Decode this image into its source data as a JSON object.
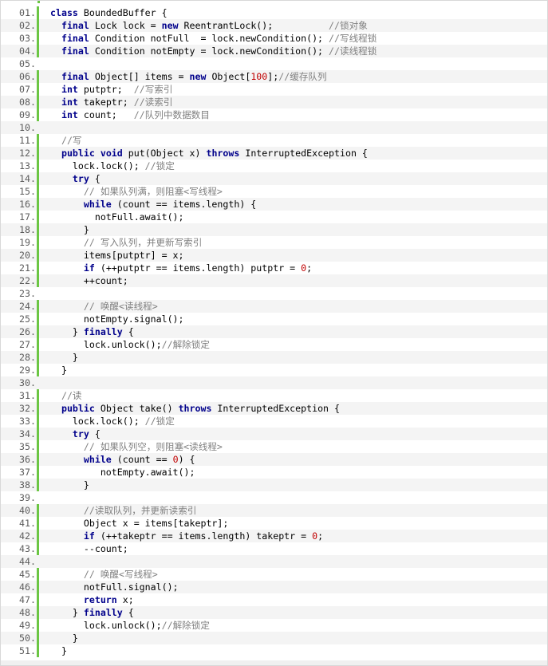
{
  "lines": [
    {
      "n": "01.",
      "segs": [
        {
          "t": "class",
          "c": "kw"
        },
        {
          "t": " BoundedBuffer {"
        }
      ]
    },
    {
      "n": "02.",
      "segs": [
        {
          "t": "  "
        },
        {
          "t": "final",
          "c": "kw"
        },
        {
          "t": " Lock lock = "
        },
        {
          "t": "new",
          "c": "kw"
        },
        {
          "t": " ReentrantLock();          "
        },
        {
          "t": "//锁对象",
          "c": "cm"
        }
      ]
    },
    {
      "n": "03.",
      "segs": [
        {
          "t": "  "
        },
        {
          "t": "final",
          "c": "kw"
        },
        {
          "t": " Condition notFull  = lock.newCondition(); "
        },
        {
          "t": "//写线程锁",
          "c": "cm"
        }
      ]
    },
    {
      "n": "04.",
      "segs": [
        {
          "t": "  "
        },
        {
          "t": "final",
          "c": "kw"
        },
        {
          "t": " Condition notEmpty = lock.newCondition(); "
        },
        {
          "t": "//读线程锁",
          "c": "cm"
        }
      ]
    },
    {
      "n": "05.",
      "segs": []
    },
    {
      "n": "06.",
      "segs": [
        {
          "t": "  "
        },
        {
          "t": "final",
          "c": "kw"
        },
        {
          "t": " Object[] items = "
        },
        {
          "t": "new",
          "c": "kw"
        },
        {
          "t": " Object["
        },
        {
          "t": "100",
          "c": "num"
        },
        {
          "t": "];"
        },
        {
          "t": "//缓存队列",
          "c": "cm"
        }
      ]
    },
    {
      "n": "07.",
      "segs": [
        {
          "t": "  "
        },
        {
          "t": "int",
          "c": "kw"
        },
        {
          "t": " putptr;  "
        },
        {
          "t": "//写索引",
          "c": "cm"
        }
      ]
    },
    {
      "n": "08.",
      "segs": [
        {
          "t": "  "
        },
        {
          "t": "int",
          "c": "kw"
        },
        {
          "t": " takeptr; "
        },
        {
          "t": "//读索引",
          "c": "cm"
        }
      ]
    },
    {
      "n": "09.",
      "segs": [
        {
          "t": "  "
        },
        {
          "t": "int",
          "c": "kw"
        },
        {
          "t": " count;   "
        },
        {
          "t": "//队列中数据数目",
          "c": "cm"
        }
      ]
    },
    {
      "n": "10.",
      "segs": []
    },
    {
      "n": "11.",
      "segs": [
        {
          "t": "  "
        },
        {
          "t": "//写",
          "c": "cm"
        }
      ]
    },
    {
      "n": "12.",
      "segs": [
        {
          "t": "  "
        },
        {
          "t": "public",
          "c": "kw"
        },
        {
          "t": " "
        },
        {
          "t": "void",
          "c": "kw"
        },
        {
          "t": " put(Object x) "
        },
        {
          "t": "throws",
          "c": "kw"
        },
        {
          "t": " InterruptedException {"
        }
      ]
    },
    {
      "n": "13.",
      "segs": [
        {
          "t": "    lock.lock(); "
        },
        {
          "t": "//锁定",
          "c": "cm"
        }
      ]
    },
    {
      "n": "14.",
      "segs": [
        {
          "t": "    "
        },
        {
          "t": "try",
          "c": "kw"
        },
        {
          "t": " {"
        }
      ]
    },
    {
      "n": "15.",
      "segs": [
        {
          "t": "      "
        },
        {
          "t": "// 如果队列满，则阻塞<写线程>",
          "c": "cm"
        }
      ]
    },
    {
      "n": "16.",
      "segs": [
        {
          "t": "      "
        },
        {
          "t": "while",
          "c": "kw"
        },
        {
          "t": " (count == items.length) {"
        }
      ]
    },
    {
      "n": "17.",
      "segs": [
        {
          "t": "        notFull.await();"
        }
      ]
    },
    {
      "n": "18.",
      "segs": [
        {
          "t": "      }"
        }
      ]
    },
    {
      "n": "19.",
      "segs": [
        {
          "t": "      "
        },
        {
          "t": "// 写入队列，并更新写索引",
          "c": "cm"
        }
      ]
    },
    {
      "n": "20.",
      "segs": [
        {
          "t": "      items[putptr] = x;"
        }
      ]
    },
    {
      "n": "21.",
      "segs": [
        {
          "t": "      "
        },
        {
          "t": "if",
          "c": "kw"
        },
        {
          "t": " (++putptr == items.length) putptr = "
        },
        {
          "t": "0",
          "c": "num"
        },
        {
          "t": ";"
        }
      ]
    },
    {
      "n": "22.",
      "segs": [
        {
          "t": "      ++count;"
        }
      ]
    },
    {
      "n": "23.",
      "segs": []
    },
    {
      "n": "24.",
      "segs": [
        {
          "t": "      "
        },
        {
          "t": "// 唤醒<读线程>",
          "c": "cm"
        }
      ]
    },
    {
      "n": "25.",
      "segs": [
        {
          "t": "      notEmpty.signal();"
        }
      ]
    },
    {
      "n": "26.",
      "segs": [
        {
          "t": "    } "
        },
        {
          "t": "finally",
          "c": "kw"
        },
        {
          "t": " {"
        }
      ]
    },
    {
      "n": "27.",
      "segs": [
        {
          "t": "      lock.unlock();"
        },
        {
          "t": "//解除锁定",
          "c": "cm"
        }
      ]
    },
    {
      "n": "28.",
      "segs": [
        {
          "t": "    }"
        }
      ]
    },
    {
      "n": "29.",
      "segs": [
        {
          "t": "  }"
        }
      ]
    },
    {
      "n": "30.",
      "segs": []
    },
    {
      "n": "31.",
      "segs": [
        {
          "t": "  "
        },
        {
          "t": "//读",
          "c": "cm"
        }
      ]
    },
    {
      "n": "32.",
      "segs": [
        {
          "t": "  "
        },
        {
          "t": "public",
          "c": "kw"
        },
        {
          "t": " Object take() "
        },
        {
          "t": "throws",
          "c": "kw"
        },
        {
          "t": " InterruptedException {"
        }
      ]
    },
    {
      "n": "33.",
      "segs": [
        {
          "t": "    lock.lock(); "
        },
        {
          "t": "//锁定",
          "c": "cm"
        }
      ]
    },
    {
      "n": "34.",
      "segs": [
        {
          "t": "    "
        },
        {
          "t": "try",
          "c": "kw"
        },
        {
          "t": " {"
        }
      ]
    },
    {
      "n": "35.",
      "segs": [
        {
          "t": "      "
        },
        {
          "t": "// 如果队列空，则阻塞<读线程>",
          "c": "cm"
        }
      ]
    },
    {
      "n": "36.",
      "segs": [
        {
          "t": "      "
        },
        {
          "t": "while",
          "c": "kw"
        },
        {
          "t": " (count == "
        },
        {
          "t": "0",
          "c": "num"
        },
        {
          "t": ") {"
        }
      ]
    },
    {
      "n": "37.",
      "segs": [
        {
          "t": "         notEmpty.await();"
        }
      ]
    },
    {
      "n": "38.",
      "segs": [
        {
          "t": "      }"
        }
      ]
    },
    {
      "n": "39.",
      "segs": []
    },
    {
      "n": "40.",
      "segs": [
        {
          "t": "      "
        },
        {
          "t": "//读取队列，并更新读索引",
          "c": "cm"
        }
      ]
    },
    {
      "n": "41.",
      "segs": [
        {
          "t": "      Object x = items[takeptr];"
        }
      ]
    },
    {
      "n": "42.",
      "segs": [
        {
          "t": "      "
        },
        {
          "t": "if",
          "c": "kw"
        },
        {
          "t": " (++takeptr == items.length) takeptr = "
        },
        {
          "t": "0",
          "c": "num"
        },
        {
          "t": ";"
        }
      ]
    },
    {
      "n": "43.",
      "segs": [
        {
          "t": "      --count;"
        }
      ]
    },
    {
      "n": "44.",
      "segs": []
    },
    {
      "n": "45.",
      "segs": [
        {
          "t": "      "
        },
        {
          "t": "// 唤醒<写线程>",
          "c": "cm"
        }
      ]
    },
    {
      "n": "46.",
      "segs": [
        {
          "t": "      notFull.signal();"
        }
      ]
    },
    {
      "n": "47.",
      "segs": [
        {
          "t": "      "
        },
        {
          "t": "return",
          "c": "kw"
        },
        {
          "t": " x;"
        }
      ]
    },
    {
      "n": "48.",
      "segs": [
        {
          "t": "    } "
        },
        {
          "t": "finally",
          "c": "kw"
        },
        {
          "t": " {"
        }
      ]
    },
    {
      "n": "49.",
      "segs": [
        {
          "t": "      lock.unlock();"
        },
        {
          "t": "//解除锁定",
          "c": "cm"
        }
      ]
    },
    {
      "n": "50.",
      "segs": [
        {
          "t": "    }"
        }
      ]
    },
    {
      "n": "51.",
      "segs": [
        {
          "t": "  }"
        }
      ]
    }
  ]
}
